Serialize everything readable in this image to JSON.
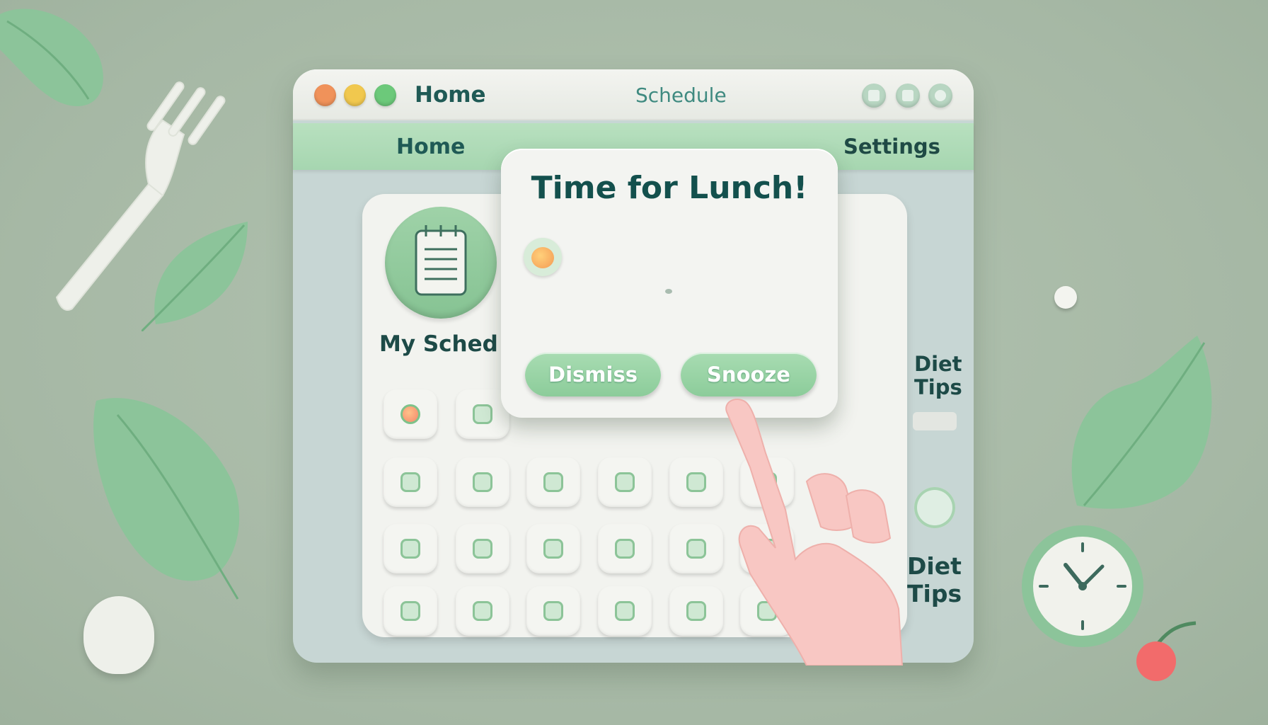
{
  "window": {
    "title_left": "Home",
    "title_center": "Schedule",
    "controls": [
      "minimize-icon",
      "maximize-icon",
      "close-icon"
    ]
  },
  "nav": {
    "home": "Home",
    "settings": "Settings"
  },
  "panel": {
    "schedule_label": "My Sched",
    "diet_tips_top": [
      "Diet",
      "Tips"
    ],
    "diet_tips_bottom": [
      "Diet",
      "Tips"
    ]
  },
  "popup": {
    "title": "Time for Lunch!",
    "dismiss_label": "Dismiss",
    "snooze_label": "Snooze",
    "icon": "peach-icon"
  },
  "colors": {
    "accent": "#8ccc9a",
    "title_text": "#13504d",
    "background": "#a6b8a5"
  }
}
